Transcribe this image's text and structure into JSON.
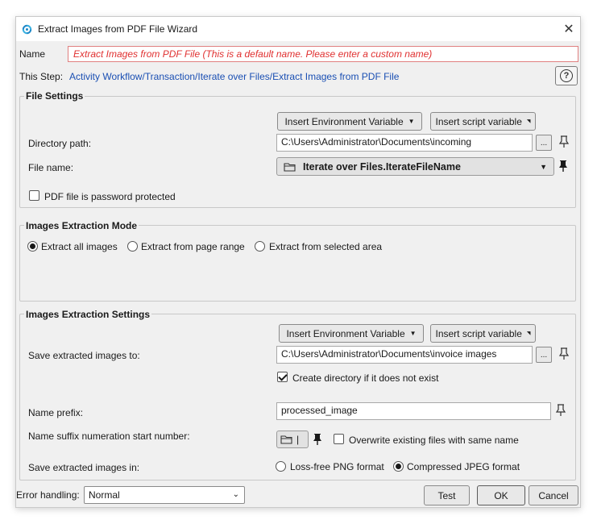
{
  "window": {
    "title": "Extract Images from PDF File Wizard",
    "close_glyph": "✕"
  },
  "header": {
    "name_label": "Name",
    "name_value": "Extract Images from PDF File  (This is a default name. Please enter a custom name)",
    "step_label": "This Step:",
    "step_path": "Activity Workflow/Transaction/Iterate over Files/Extract Images from PDF File",
    "help_glyph": "?"
  },
  "file_settings": {
    "title": "File Settings",
    "insert_env_label": "Insert Environment Variable",
    "insert_script_label": "Insert script variable",
    "directory_label": "Directory path:",
    "directory_value": "C:\\Users\\Administrator\\Documents\\incoming",
    "browse_label": "...",
    "file_name_label": "File name:",
    "file_name_value": "Iterate over Files.IterateFileName",
    "password_label": "PDF file is password protected",
    "password_checked": false
  },
  "extraction_mode": {
    "title": "Images Extraction Mode",
    "options": [
      {
        "label": "Extract all images",
        "selected": true
      },
      {
        "label": "Extract from page range",
        "selected": false
      },
      {
        "label": "Extract from selected area",
        "selected": false
      }
    ]
  },
  "extraction_settings": {
    "title": "Images Extraction Settings",
    "insert_env_label": "Insert Environment Variable",
    "insert_script_label": "Insert script variable",
    "save_to_label": "Save extracted images to:",
    "save_to_value": "C:\\Users\\Administrator\\Documents\\invoice images",
    "browse_label": "...",
    "create_dir_label": "Create directory if it does not exist",
    "create_dir_checked": true,
    "prefix_label": "Name prefix:",
    "prefix_value": "processed_image",
    "suffix_label": "Name suffix numeration start number:",
    "overwrite_label": "Overwrite existing files with same name",
    "overwrite_checked": false,
    "format_label": "Save extracted images in:",
    "formats": [
      {
        "label": "Loss-free PNG format",
        "selected": false
      },
      {
        "label": "Compressed JPEG format",
        "selected": true
      }
    ]
  },
  "footer": {
    "error_label": "Error handling:",
    "error_value": "Normal",
    "test_label": "Test",
    "ok_label": "OK",
    "cancel_label": "Cancel"
  },
  "colors": {
    "accent_link": "#1a4fb3",
    "warning_red": "#e03030"
  }
}
